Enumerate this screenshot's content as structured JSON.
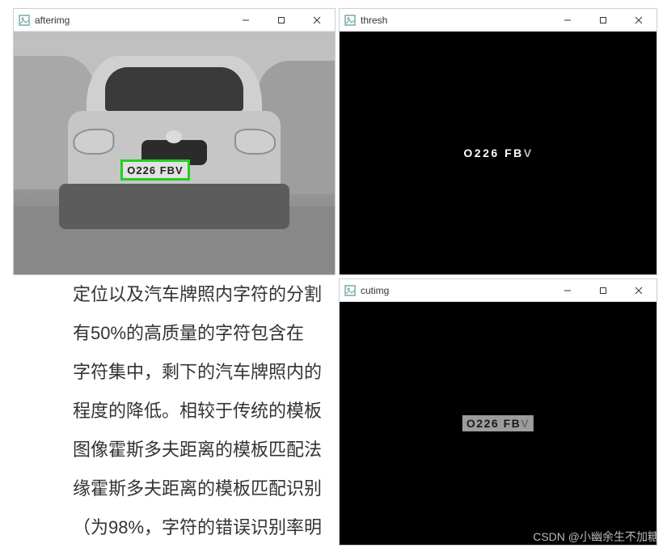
{
  "windows": {
    "afterimg": {
      "title": "afterimg"
    },
    "thresh": {
      "title": "thresh"
    },
    "cutimg": {
      "title": "cutimg"
    }
  },
  "plate": {
    "text": "O226 FBV",
    "chars": [
      "O",
      "2",
      "2",
      "6",
      "F",
      "B",
      "V"
    ]
  },
  "article": {
    "line1": "定位以及汽车牌照内字符的分割",
    "line2": "有50%的高质量的字符包含在",
    "line3": "字符集中，剩下的汽车牌照内的",
    "line4": "程度的降低。相较于传统的模板",
    "line5": "图像霍斯多夫距离的模板匹配法",
    "line6": "缘霍斯多夫距离的模板匹配识别",
    "line7": "（为98%，字符的错误识别率明"
  },
  "watermark": "CSDN @小幽余生不加糖"
}
